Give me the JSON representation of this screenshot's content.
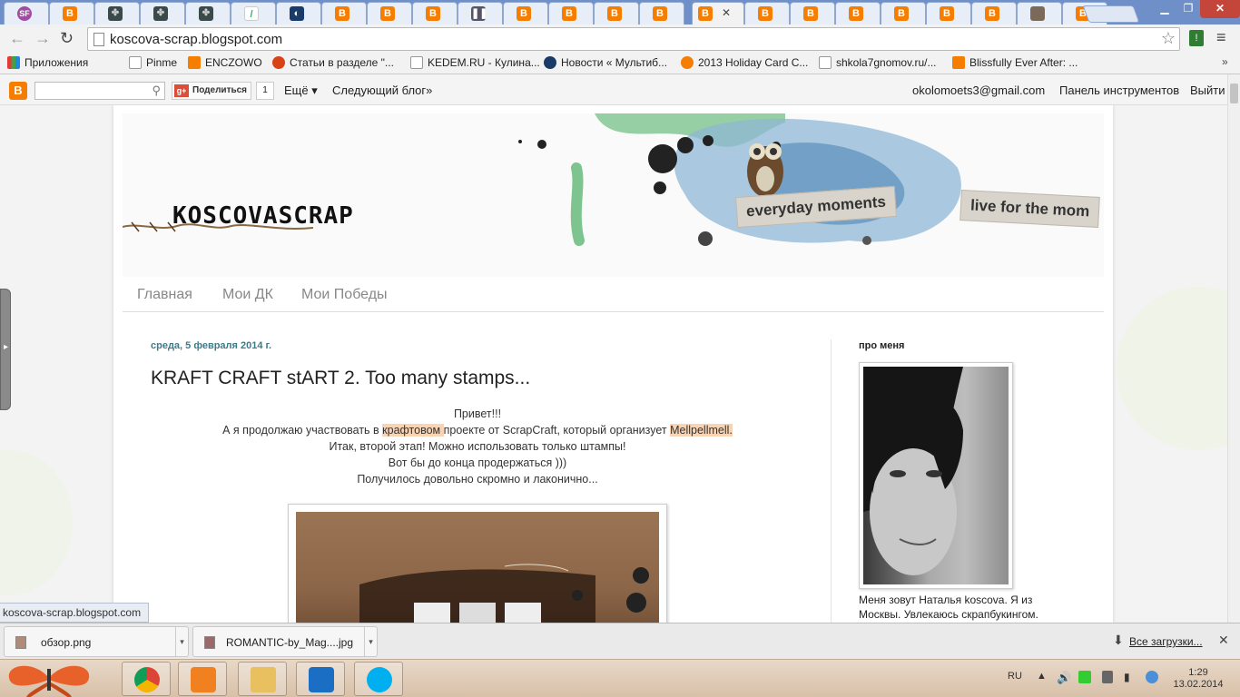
{
  "browser": {
    "tabs": [
      {
        "icon": "sf-icon"
      },
      {
        "icon": "blogger-icon"
      },
      {
        "icon": "grid-icon"
      },
      {
        "icon": "grid-icon"
      },
      {
        "icon": "pen-icon"
      },
      {
        "icon": "news-icon"
      },
      {
        "icon": "blogger-icon"
      },
      {
        "icon": "blogger-icon"
      },
      {
        "icon": "blogger-icon"
      },
      {
        "icon": "pause-icon"
      },
      {
        "icon": "blogger-icon"
      },
      {
        "icon": "blogger-icon"
      },
      {
        "icon": "blogger-icon"
      },
      {
        "icon": "blogger-icon"
      },
      {
        "icon": "blogger-icon",
        "active": true
      },
      {
        "icon": "blogger-icon"
      },
      {
        "icon": "blogger-icon"
      },
      {
        "icon": "blogger-icon"
      },
      {
        "icon": "blogger-icon"
      },
      {
        "icon": "blogger-icon"
      },
      {
        "icon": "blogger-icon"
      },
      {
        "icon": "photo-icon"
      },
      {
        "icon": "blogger-icon"
      }
    ],
    "url": "koscova-scrap.blogspot.com",
    "bookmarks": [
      {
        "label": "Приложения",
        "icon": "apps-icon"
      },
      {
        "label": "Pinme",
        "icon": "page-icon"
      },
      {
        "label": "ENCZOWO",
        "icon": "blogger-icon"
      },
      {
        "label": "Статьи в разделе \"...",
        "icon": "pen-icon"
      },
      {
        "label": "KEDEM.RU - Кулина...",
        "icon": "page-icon"
      },
      {
        "label": "Новости « Мультиб...",
        "icon": "news-icon"
      },
      {
        "label": "2013 Holiday Card C...",
        "icon": "circle-icon"
      },
      {
        "label": "shkola7gnomov.ru/...",
        "icon": "page-icon"
      },
      {
        "label": "Blissfully Ever After: ...",
        "icon": "blogger-icon"
      }
    ],
    "bookmarks_more": "»",
    "status_url": "koscova-scrap.blogspot.com"
  },
  "navbar": {
    "share_label": "Поделиться",
    "share_count": "1",
    "more_label": "Ещё ▾",
    "next_blog": "Следующий блог»",
    "user_email": "okolomoets3@gmail.com",
    "dashboard": "Панель инструментов",
    "sign_out": "Выйти"
  },
  "blog": {
    "logo_text": "KOSCOVASCRAP",
    "banner_tape_1": "everyday moments",
    "banner_tape_2": "live for the mom",
    "tabs": [
      "Главная",
      "Мои ДК",
      "Мои Победы"
    ],
    "post": {
      "date": "среда, 5 февраля 2014 г.",
      "title": "KRAFT CRAFT stART 2. Too many stamps...",
      "line1": "Привет!!!",
      "line2_a": "А я продолжаю участвовать в ",
      "line2_link1": "крафтовом ",
      "line2_b": "проекте от ScrapCraft, который организует ",
      "line2_link2": "Mellpellmell.",
      "line3": "Итак, второй этап! Можно использовать только штампы!",
      "line4": "Вот бы до конца продержаться )))",
      "line5": "Получилось довольно скромно и лаконично..."
    },
    "sidebar": {
      "title": "про меня",
      "about_line1": "Меня зовут Наталья koscova. Я из",
      "about_line2": "Москвы. Увлекаюсь скрапбукингом."
    }
  },
  "downloads": {
    "items": [
      "обзор.png",
      "ROMANTIC-by_Mag....jpg"
    ],
    "all_label": "Все загрузки..."
  },
  "taskbar": {
    "lang": "RU",
    "time": "1:29",
    "date": "13.02.2014"
  },
  "colors": {
    "blogger_orange": "#f57d00",
    "date_teal": "#3d7b8a",
    "highlight": "#f8d4b4",
    "tab_strip": "#6f8fc9"
  }
}
